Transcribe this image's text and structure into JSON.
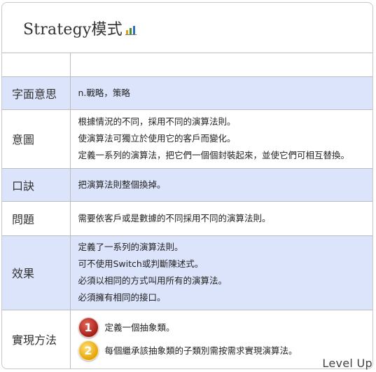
{
  "title": "Strategy模式",
  "title_icon": "bar-chart-icon",
  "rows": [
    {
      "key": "字面意思",
      "lines": [
        "n.戰略，策略"
      ]
    },
    {
      "key": "意圖",
      "lines": [
        "根據情況的不同，採用不同的演算法則。",
        "使演算法可獨立於使用它的客戶而變化。",
        "定義一系列的演算法，把它們一個個封裝起來，並使它們可相互替換。"
      ]
    },
    {
      "key": "口訣",
      "lines": [
        "把演算法則整個換掉。"
      ]
    },
    {
      "key": "問題",
      "lines": [
        "需要依客戶或是數據的不同採用不同的演算法則。"
      ]
    },
    {
      "key": "效果",
      "lines": [
        "定義了一系列的演算法則。",
        "可不使用Switch或判斷陳述式。",
        "必須以相同的方式叫用所有的演算法。",
        "必須擁有相同的接口。"
      ]
    },
    {
      "key": "實現方法",
      "steps": [
        {
          "num": "1",
          "text": "定義一個抽象類。"
        },
        {
          "num": "2",
          "text": "每個繼承該抽象類的子類別需按需求實現演算法。"
        }
      ]
    }
  ],
  "colors": {
    "highlight_row": "#dbe4fb",
    "badge_1": "#c0392b",
    "badge_2": "#f2b705"
  },
  "watermark": "Level Up"
}
